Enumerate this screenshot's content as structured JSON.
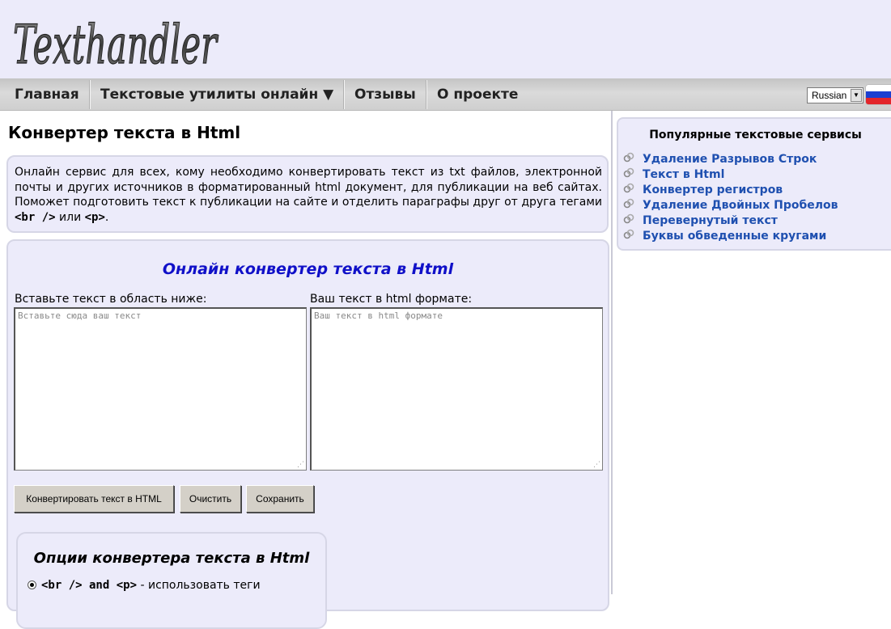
{
  "header": {
    "logo_text": "Texthandler"
  },
  "nav": {
    "items": [
      {
        "label": "Главная"
      },
      {
        "label": "Текстовые утилиты онлайн ▼"
      },
      {
        "label": "Отзывы"
      },
      {
        "label": "О проекте"
      }
    ],
    "language": "Russian"
  },
  "main": {
    "title": "Конвертер текста в Html",
    "description_text": "Онлайн сервис для всех, кому необходимо конвертировать текст из txt файлов, электронной почты и других источников в форматированный html документ, для публикации на веб сайтах. Поможет подготовить текст к публикации на сайте и отделить параграфы друг от друга тегами ",
    "description_tag1": "<br />",
    "description_or": " или ",
    "description_tag2": "<p>",
    "description_end": ".",
    "tool": {
      "title": "Онлайн конвертер текста в Html",
      "input_label": "Вставьте текст в область ниже:",
      "input_placeholder": "Вставьте сюда ваш текст",
      "output_label": "Ваш текст в html формате:",
      "output_placeholder": "Ваш текст в html формате",
      "convert_button": "Конвертировать текст в HTML",
      "clear_button": "Очистить",
      "save_button": "Сохранить"
    },
    "options": {
      "title": "Опции конвертера текста в Html",
      "option1_code": "<br /> and <p>",
      "option1_text": " - использовать теги"
    }
  },
  "sidebar": {
    "title": "Популярные текстовые сервисы",
    "links": [
      {
        "label": "Удаление Разрывов Строк"
      },
      {
        "label": "Текст в Html"
      },
      {
        "label": "Конвертер регистров"
      },
      {
        "label": "Удаление Двойных Пробелов"
      },
      {
        "label": "Перевернутый текст"
      },
      {
        "label": "Буквы обведенные кругами"
      }
    ]
  },
  "colors": {
    "header_bg": "#ecebfa",
    "panel_bg": "#ecebfa",
    "link": "#1f50b0",
    "tool_title": "#1010c8"
  }
}
